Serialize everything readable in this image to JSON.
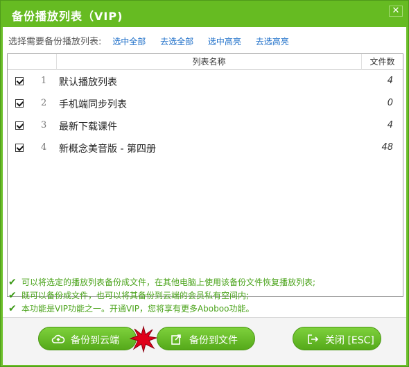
{
  "window": {
    "title": "备份播放列表（VIP)",
    "close_glyph": "✕"
  },
  "toolbar": {
    "label": "选择需要备份播放列表:",
    "select_all": "选中全部",
    "deselect_all": "去选全部",
    "select_highlight": "选中高亮",
    "deselect_highlight": "去选高亮"
  },
  "list": {
    "headers": {
      "name": "列表名称",
      "count": "文件数"
    },
    "rows": [
      {
        "index": "1",
        "name": "默认播放列表",
        "count": "4",
        "checked": true
      },
      {
        "index": "2",
        "name": "手机端同步列表",
        "count": "0",
        "checked": true
      },
      {
        "index": "3",
        "name": "最新下载课件",
        "count": "4",
        "checked": true
      },
      {
        "index": "4",
        "name": "新概念美音版 - 第四册",
        "count": "48",
        "checked": true
      }
    ]
  },
  "notes": [
    "可以将选定的播放列表备份成文件，在其他电脑上使用该备份文件恢复播放列表;",
    "既可以备份成文件，也可以将其备份到云端的会员私有空间内;",
    "本功能是VIP功能之一。开通VIP，您将享有更多Aboboo功能。"
  ],
  "buttons": {
    "backup_cloud": "备份到云端",
    "backup_file": "备份到文件",
    "close": "关闭 [ESC]"
  },
  "colors": {
    "accent_green": "#66bb22",
    "link_blue": "#1e6fc9",
    "note_green": "#4aa31a",
    "highlight_star": "#e0001a"
  },
  "icons": [
    "cloud-upload-icon",
    "file-export-icon",
    "exit-icon",
    "check-icon",
    "close-icon",
    "starburst-highlight-icon"
  ]
}
